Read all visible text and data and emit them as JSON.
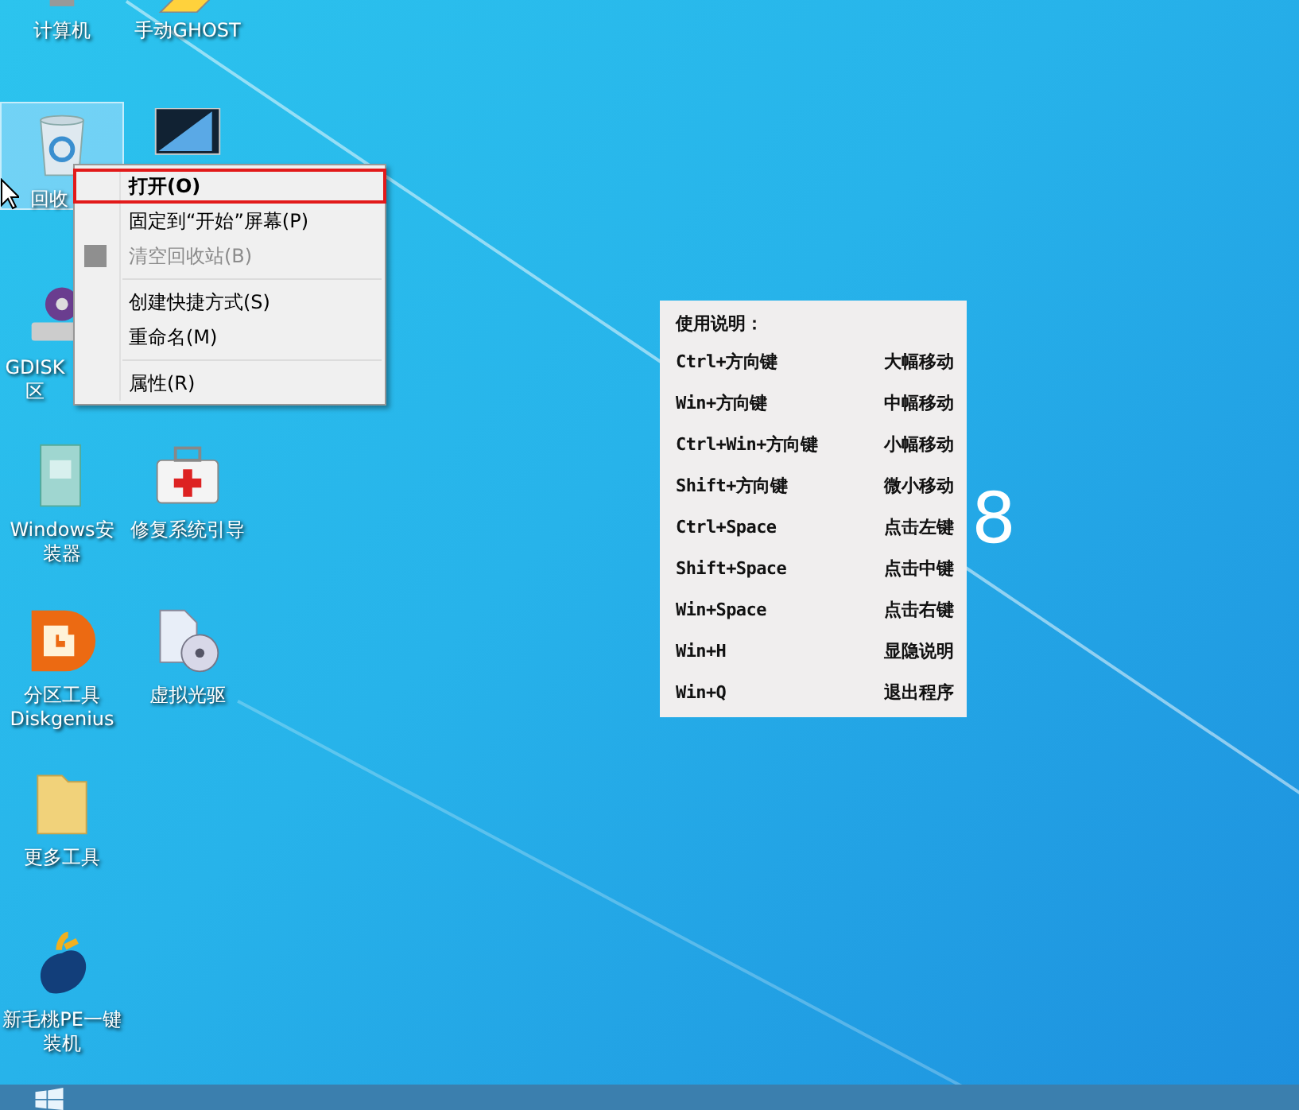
{
  "desktop_icons": [
    {
      "kind": "computer",
      "lines": [
        "计算机"
      ],
      "selected": false
    },
    {
      "kind": "ghost",
      "lines": [
        "手动GHOST"
      ],
      "selected": false
    },
    {
      "kind": "recycle",
      "lines": [
        "回收"
      ],
      "selected": true
    },
    {
      "kind": "monitor",
      "selected": false
    },
    {
      "kind": "gear",
      "lines": [
        "GDISK",
        "区"
      ],
      "selected": false
    },
    {
      "kind": "installer",
      "lines": [
        "Windows安",
        "装器"
      ],
      "selected": false
    },
    {
      "kind": "firstaid",
      "lines": [
        "修复系统引导"
      ],
      "selected": false
    },
    {
      "kind": "diskgenius",
      "lines": [
        "分区工具",
        "Diskgenius"
      ],
      "selected": false
    },
    {
      "kind": "disc",
      "lines": [
        "虚拟光驱"
      ],
      "selected": false
    },
    {
      "kind": "folder",
      "lines": [
        "更多工具"
      ],
      "selected": false
    },
    {
      "kind": "peach",
      "lines": [
        "新毛桃PE一键",
        "装机"
      ],
      "selected": false
    }
  ],
  "context_menu": {
    "items": [
      {
        "kind": "item",
        "label": "打开(O)",
        "bold": true,
        "disabled": false,
        "selected": true
      },
      {
        "kind": "item",
        "label": "固定到“开始”屏幕(P)",
        "bold": false,
        "disabled": false,
        "selected": false
      },
      {
        "kind": "item",
        "label": "清空回收站(B)",
        "bold": false,
        "disabled": true,
        "selected": false
      },
      {
        "kind": "separator"
      },
      {
        "kind": "item",
        "label": "创建快捷方式(S)",
        "bold": false,
        "disabled": false,
        "selected": false
      },
      {
        "kind": "item",
        "label": "重命名(M)",
        "bold": false,
        "disabled": false,
        "selected": false
      },
      {
        "kind": "separator"
      },
      {
        "kind": "item",
        "label": "属性(R)",
        "bold": false,
        "disabled": false,
        "selected": false
      }
    ]
  },
  "wallpaper_text": "8",
  "help_panel": {
    "title": "使用说明：",
    "rows": [
      {
        "keys": "Ctrl+方向键",
        "action": "大幅移动"
      },
      {
        "keys": "Win+方向键",
        "action": "中幅移动"
      },
      {
        "keys": "Ctrl+Win+方向键",
        "action": "小幅移动"
      },
      {
        "keys": "Shift+方向键",
        "action": "微小移动"
      },
      {
        "keys": "Ctrl+Space",
        "action": "点击左键"
      },
      {
        "keys": "Shift+Space",
        "action": "点击中键"
      },
      {
        "keys": "Win+Space",
        "action": "点击右键"
      },
      {
        "keys": "Win+H",
        "action": "显隐说明"
      },
      {
        "keys": "Win+Q",
        "action": "退出程序"
      }
    ]
  }
}
